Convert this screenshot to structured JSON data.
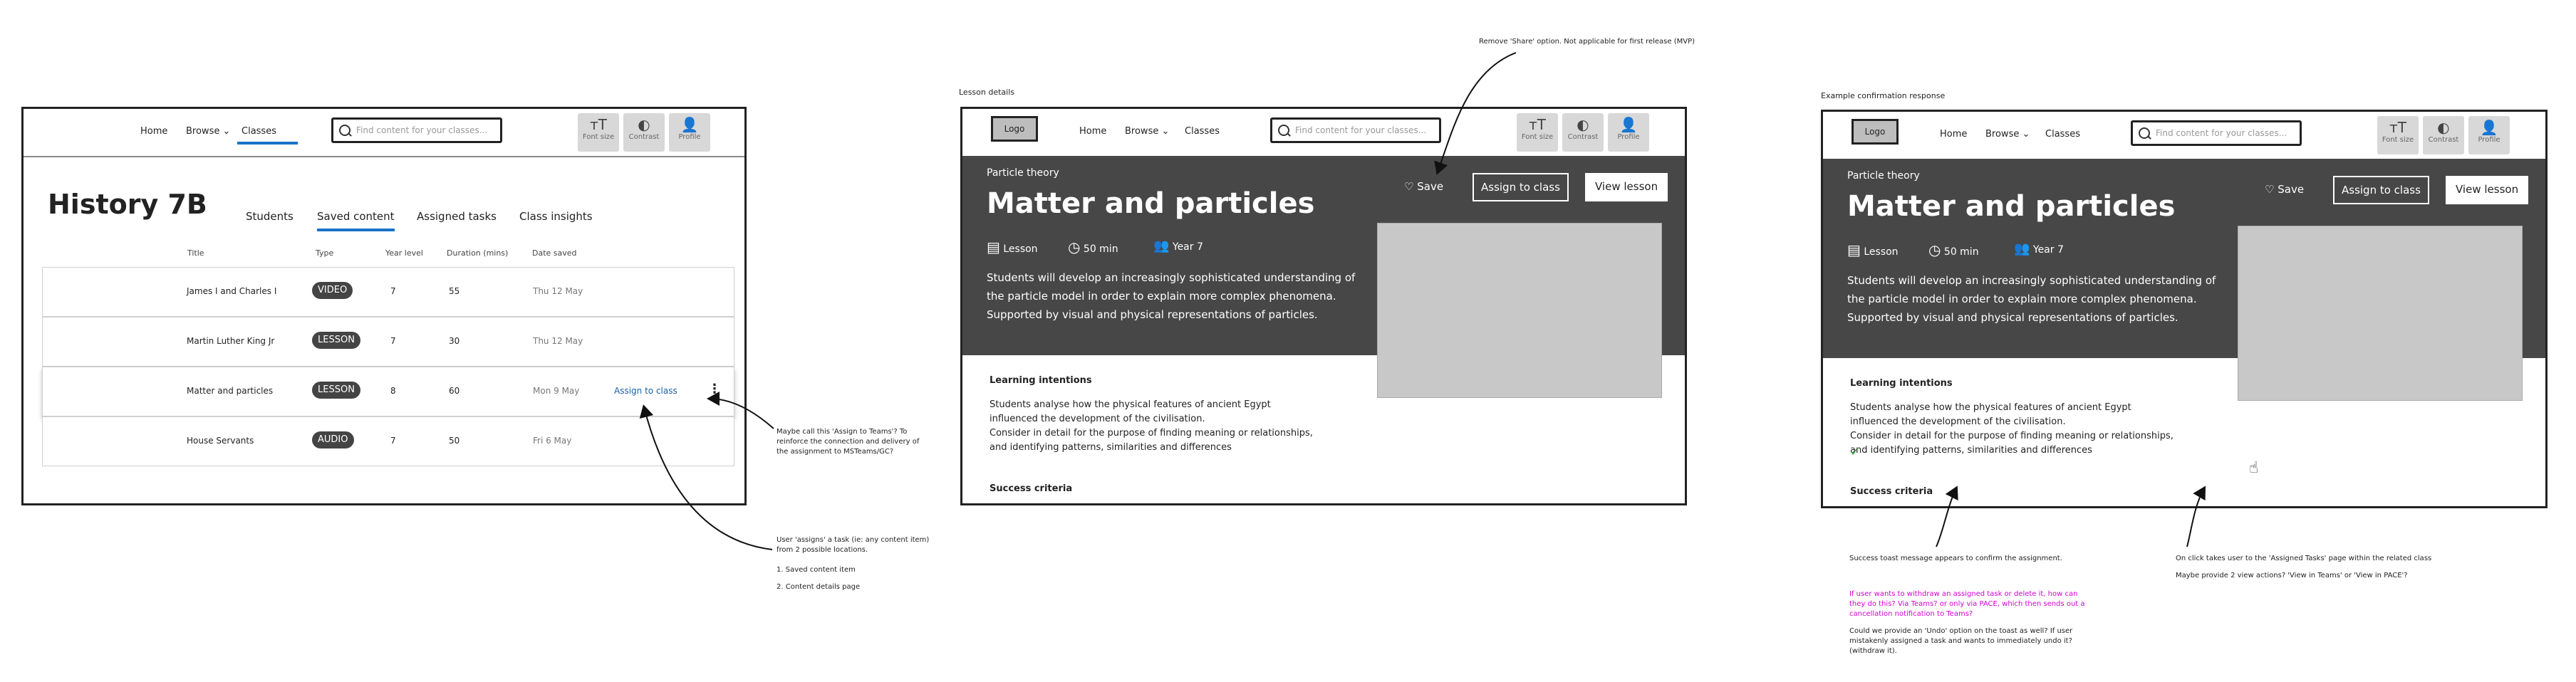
{
  "frame1": {
    "nav": {
      "home": "Home",
      "browse": "Browse",
      "classes": "Classes"
    },
    "search_placeholder": "Find content for your classes...",
    "tools": {
      "font_size": "Font size",
      "contrast": "Contrast",
      "profile": "Profile"
    },
    "class_title": "History 7B",
    "tabs": [
      "Students",
      "Saved content",
      "Assigned tasks",
      "Class insights"
    ],
    "columns": [
      "Title",
      "Type",
      "Year level",
      "Duration (mins)",
      "Date saved"
    ],
    "rows": [
      {
        "title": "James I and Charles I",
        "type": "VIDEO",
        "year": "7",
        "duration": "55",
        "date": "Thu 12 May"
      },
      {
        "title": "Martin Luther King Jr",
        "type": "LESSON",
        "year": "7",
        "duration": "30",
        "date": "Thu 12 May"
      },
      {
        "title": "Matter and particles",
        "type": "LESSON",
        "year": "8",
        "duration": "60",
        "date": "Mon 9 May",
        "action": "Assign to class"
      },
      {
        "title": "House Servants",
        "type": "AUDIO",
        "year": "7",
        "duration": "50",
        "date": "Fri 6 May"
      }
    ]
  },
  "frame2": {
    "label": "Lesson details",
    "logo": "Logo",
    "nav": {
      "home": "Home",
      "browse": "Browse",
      "classes": "Classes"
    },
    "search_placeholder": "Find content for your classes...",
    "tools": {
      "font_size": "Font size",
      "contrast": "Contrast",
      "profile": "Profile"
    },
    "kicker": "Particle theory",
    "title": "Matter and particles",
    "meta": {
      "type": "Lesson",
      "duration": "50 min",
      "year": "Year 7"
    },
    "description": "Students will develop an increasingly sophisticated understanding of the particle model in order to explain more complex phenomena. Supported by visual and physical representations of particles.",
    "save": "Save",
    "assign": "Assign to class",
    "view": "View lesson",
    "learning_heading": "Learning intentions",
    "learning_body": [
      "Students analyse how the physical features of ancient Egypt",
      "influenced the development of the civilisation.",
      "Consider in detail for the purpose of finding meaning or relationships,",
      "and identifying patterns, similarities and differences"
    ],
    "success_heading": "Success criteria"
  },
  "frame3": {
    "label": "Example confirmation response",
    "logo": "Logo",
    "nav": {
      "home": "Home",
      "browse": "Browse",
      "classes": "Classes"
    },
    "search_placeholder": "Find content for your classes...",
    "tools": {
      "font_size": "Font size",
      "contrast": "Contrast",
      "profile": "Profile"
    },
    "kicker": "Particle theory",
    "title": "Matter and particles",
    "meta": {
      "type": "Lesson",
      "duration": "50 min",
      "year": "Year 7"
    },
    "description": "Students will develop an increasingly sophisticated understanding of the particle model in order to explain more complex phenomena. Supported by visual and physical representations of particles.",
    "save": "Save",
    "assign": "Assign to class",
    "view": "View lesson",
    "learning_heading": "Learning intentions",
    "learning_body": [
      "Students analyse how the physical features of ancient Egypt",
      "influenced the development of the civilisation.",
      "Consider in detail for the purpose of finding meaning or relationships,",
      "and identifying patterns, similarities and differences"
    ],
    "success_heading": "Success criteria"
  },
  "annotations": {
    "remove_share": "Remove 'Share' option. Not applicable for first release (MVP)",
    "teams_note": "Maybe call this 'Assign to Teams'? To reinforce the connection and delivery of the assignment to MSTeams/GC?",
    "assign_note": "User 'assigns' a task (ie: any content item) from 2 possible locations.",
    "assign_list": [
      "1. Saved content item",
      "2. Content details page"
    ],
    "toast_note": "Success toast message appears to confirm the assignment.",
    "withdraw_note": "If user wants to withdraw an assigned task or delete it, how can they do this? Via Teams? or only via PACE, which then sends out a cancellation notification to Teams?",
    "undo_note": "Could we provide an 'Undo' option on the toast as well? If user mistakenly assigned a task and wants to immediately undo it? (withdraw it).",
    "click_note": "On click takes user to the 'Assigned Tasks' page within the related class",
    "view_actions_note": "Maybe provide 2 view actions? 'View in Teams' or 'View in PACE'?"
  }
}
